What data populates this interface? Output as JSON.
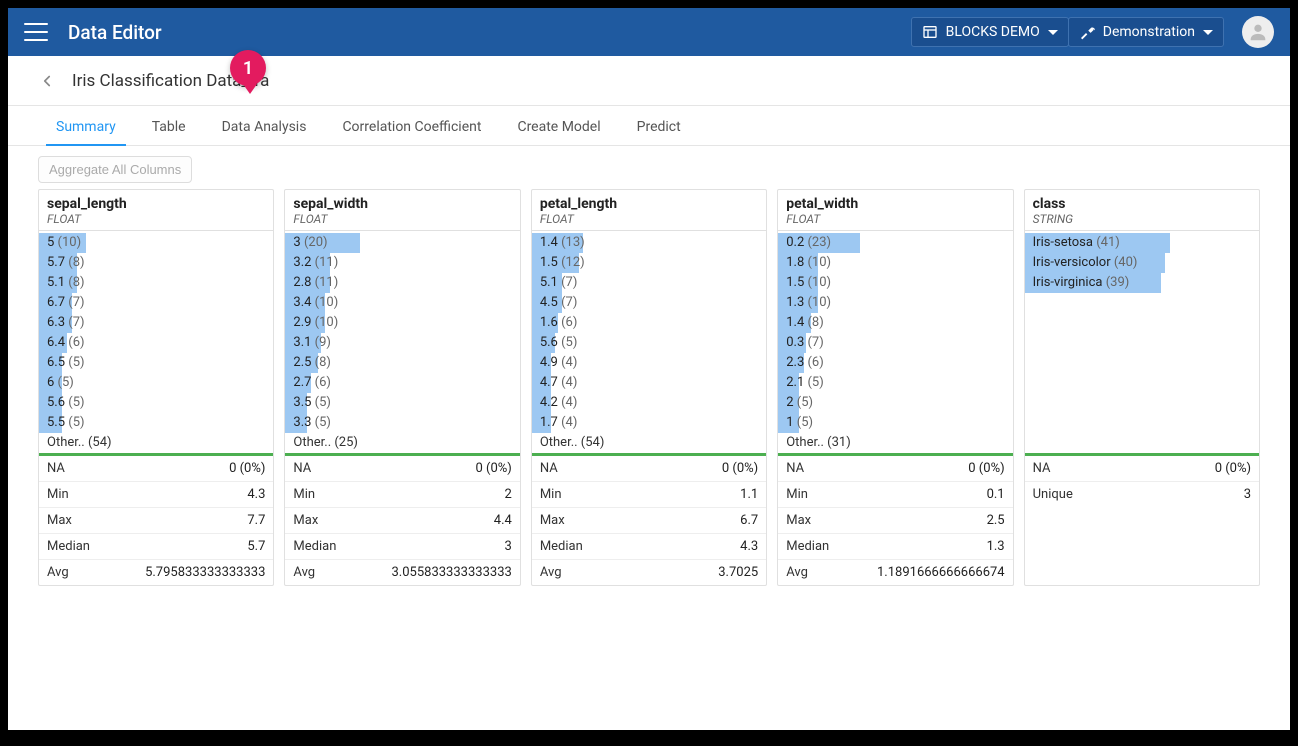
{
  "header": {
    "app_title": "Data Editor",
    "project_btn": "BLOCKS DEMO",
    "demo_btn": "Demonstration"
  },
  "breadcrumb": {
    "title": "Iris Classification Data_tra"
  },
  "marker": {
    "num": "1"
  },
  "tabs": {
    "items": [
      "Summary",
      "Table",
      "Data Analysis",
      "Correlation Coefficient",
      "Create Model",
      "Predict"
    ],
    "active": 0
  },
  "toolbar": {
    "aggregate": "Aggregate All Columns"
  },
  "stat_labels": {
    "na": "NA",
    "min": "Min",
    "max": "Max",
    "median": "Median",
    "avg": "Avg",
    "unique": "Unique"
  },
  "columns": [
    {
      "name": "sepal_length",
      "type": "FLOAT",
      "dist": [
        {
          "label": "5",
          "count": 10,
          "bar": 20
        },
        {
          "label": "5.7",
          "count": 8,
          "bar": 16
        },
        {
          "label": "5.1",
          "count": 8,
          "bar": 16
        },
        {
          "label": "6.7",
          "count": 7,
          "bar": 14
        },
        {
          "label": "6.3",
          "count": 7,
          "bar": 14
        },
        {
          "label": "6.4",
          "count": 6,
          "bar": 12
        },
        {
          "label": "6.5",
          "count": 5,
          "bar": 10
        },
        {
          "label": "6",
          "count": 5,
          "bar": 10
        },
        {
          "label": "5.6",
          "count": 5,
          "bar": 10
        },
        {
          "label": "5.5",
          "count": 5,
          "bar": 10
        }
      ],
      "other": "Other.. (54)",
      "stats": [
        {
          "k": "NA",
          "v": "0 (0%)"
        },
        {
          "k": "Min",
          "v": "4.3"
        },
        {
          "k": "Max",
          "v": "7.7"
        },
        {
          "k": "Median",
          "v": "5.7"
        },
        {
          "k": "Avg",
          "v": "5.795833333333333"
        }
      ]
    },
    {
      "name": "sepal_width",
      "type": "FLOAT",
      "dist": [
        {
          "label": "3",
          "count": 20,
          "bar": 32
        },
        {
          "label": "3.2",
          "count": 11,
          "bar": 19
        },
        {
          "label": "2.8",
          "count": 11,
          "bar": 19
        },
        {
          "label": "3.4",
          "count": 10,
          "bar": 17
        },
        {
          "label": "2.9",
          "count": 10,
          "bar": 17
        },
        {
          "label": "3.1",
          "count": 9,
          "bar": 15
        },
        {
          "label": "2.5",
          "count": 8,
          "bar": 14
        },
        {
          "label": "2.7",
          "count": 6,
          "bar": 11
        },
        {
          "label": "3.5",
          "count": 5,
          "bar": 9
        },
        {
          "label": "3.3",
          "count": 5,
          "bar": 9
        }
      ],
      "other": "Other.. (25)",
      "stats": [
        {
          "k": "NA",
          "v": "0 (0%)"
        },
        {
          "k": "Min",
          "v": "2"
        },
        {
          "k": "Max",
          "v": "4.4"
        },
        {
          "k": "Median",
          "v": "3"
        },
        {
          "k": "Avg",
          "v": "3.055833333333333"
        }
      ]
    },
    {
      "name": "petal_length",
      "type": "FLOAT",
      "dist": [
        {
          "label": "1.4",
          "count": 13,
          "bar": 22
        },
        {
          "label": "1.5",
          "count": 12,
          "bar": 20
        },
        {
          "label": "5.1",
          "count": 7,
          "bar": 13
        },
        {
          "label": "4.5",
          "count": 7,
          "bar": 13
        },
        {
          "label": "1.6",
          "count": 6,
          "bar": 11
        },
        {
          "label": "5.6",
          "count": 5,
          "bar": 10
        },
        {
          "label": "4.9",
          "count": 4,
          "bar": 8
        },
        {
          "label": "4.7",
          "count": 4,
          "bar": 8
        },
        {
          "label": "4.2",
          "count": 4,
          "bar": 8
        },
        {
          "label": "1.7",
          "count": 4,
          "bar": 8
        }
      ],
      "other": "Other.. (54)",
      "stats": [
        {
          "k": "NA",
          "v": "0 (0%)"
        },
        {
          "k": "Min",
          "v": "1.1"
        },
        {
          "k": "Max",
          "v": "6.7"
        },
        {
          "k": "Median",
          "v": "4.3"
        },
        {
          "k": "Avg",
          "v": "3.7025"
        }
      ]
    },
    {
      "name": "petal_width",
      "type": "FLOAT",
      "dist": [
        {
          "label": "0.2",
          "count": 23,
          "bar": 35
        },
        {
          "label": "1.8",
          "count": 10,
          "bar": 17
        },
        {
          "label": "1.5",
          "count": 10,
          "bar": 17
        },
        {
          "label": "1.3",
          "count": 10,
          "bar": 17
        },
        {
          "label": "1.4",
          "count": 8,
          "bar": 14
        },
        {
          "label": "0.3",
          "count": 7,
          "bar": 12
        },
        {
          "label": "2.3",
          "count": 6,
          "bar": 11
        },
        {
          "label": "2.1",
          "count": 5,
          "bar": 9
        },
        {
          "label": "2",
          "count": 5,
          "bar": 9
        },
        {
          "label": "1",
          "count": 5,
          "bar": 9
        }
      ],
      "other": "Other.. (31)",
      "stats": [
        {
          "k": "NA",
          "v": "0 (0%)"
        },
        {
          "k": "Min",
          "v": "0.1"
        },
        {
          "k": "Max",
          "v": "2.5"
        },
        {
          "k": "Median",
          "v": "1.3"
        },
        {
          "k": "Avg",
          "v": "1.1891666666666674"
        }
      ]
    },
    {
      "name": "class",
      "type": "STRING",
      "dist": [
        {
          "label": "Iris-setosa",
          "count": 41,
          "bar": 62
        },
        {
          "label": "Iris-versicolor",
          "count": 40,
          "bar": 60
        },
        {
          "label": "Iris-virginica",
          "count": 39,
          "bar": 58
        }
      ],
      "other": null,
      "stats": [
        {
          "k": "NA",
          "v": "0 (0%)"
        },
        {
          "k": "Unique",
          "v": "3"
        }
      ],
      "pad_rows": 7
    }
  ]
}
